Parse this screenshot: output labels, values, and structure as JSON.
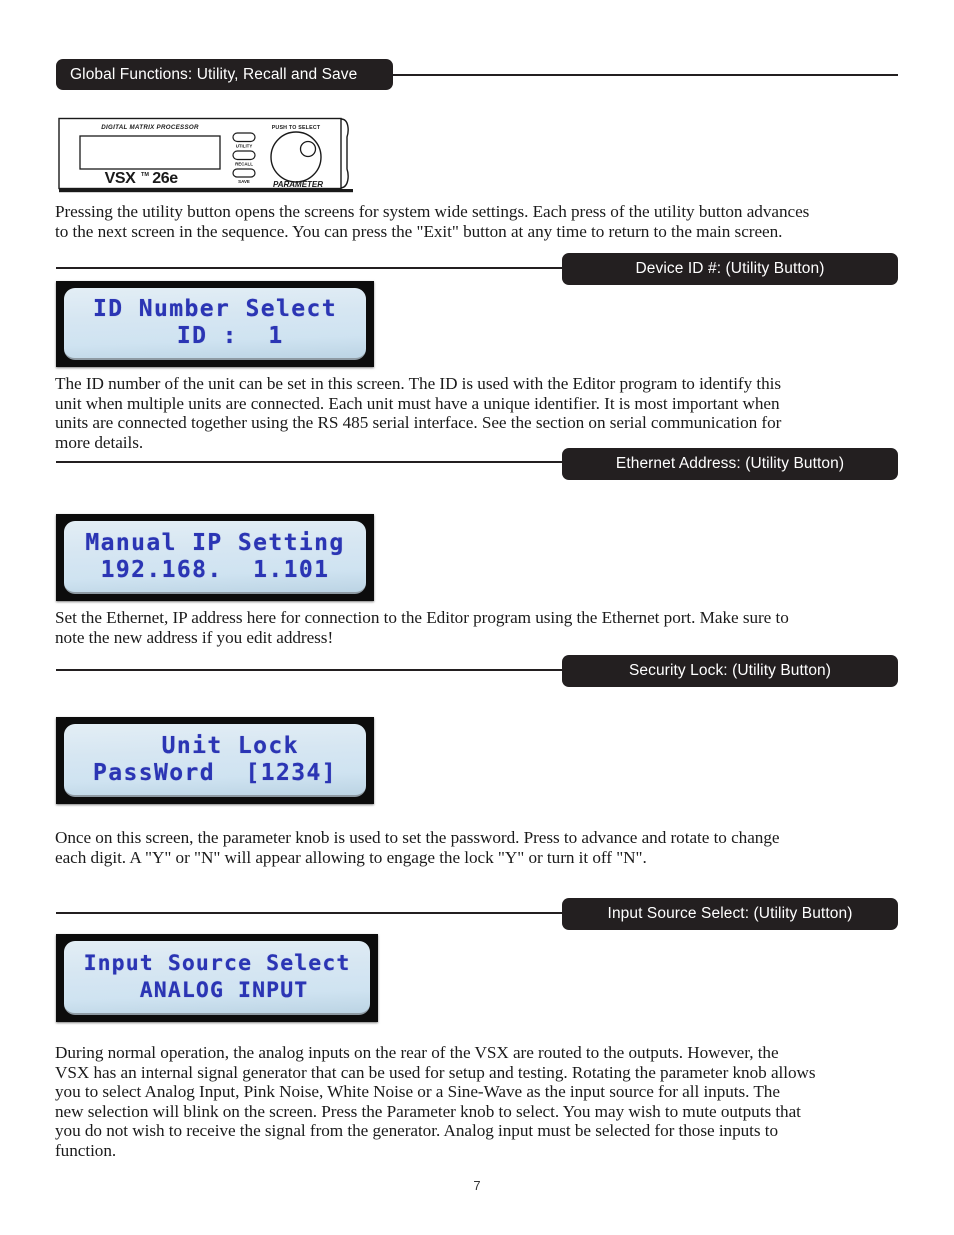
{
  "document": {
    "page_number": "7",
    "section_title": "Global Functions: Utility, Recall and Save"
  },
  "device_illustration": {
    "name": "vsx-26e-front-panel",
    "top_label": "DIGITAL MATRIX PROCESSOR",
    "brand": "VSX",
    "trademark": "™",
    "model": "26e",
    "knob_label_top": "PUSH TO SELECT",
    "knob_label_bottom": "PARAMETER",
    "buttons": [
      "UTILITY",
      "RECALL",
      "SAVE"
    ]
  },
  "intro_paragraph": "Pressing the utility button opens the screens for system wide settings.  Each press of the utility button advances\nto the next screen in the sequence.  You can press the \"Exit\" button at any time to return to the main screen.",
  "sections": [
    {
      "banner": "Device ID #: (Utility Button)",
      "lcd": {
        "line1": "ID Number Select",
        "line2": "  ID :  1"
      },
      "paragraph": "The ID number of the unit can be set in this screen.  The ID is used with the Editor program to identify this\nunit when multiple units are connected.  Each unit must have a unique identifier.  It is most important when\nunits are connected together using the RS 485 serial interface.  See the section on serial communication for\nmore details."
    },
    {
      "banner": "Ethernet Address: (Utility Button)",
      "lcd": {
        "line1": "Manual IP Setting",
        "line2": "192.168.  1.101"
      },
      "paragraph": "Set the Ethernet, IP address here for connection to the Editor program using the Ethernet port. Make sure to\nnote the new address if you edit address!"
    },
    {
      "banner": "Security Lock: (Utility Button)",
      "lcd": {
        "line1": "  Unit Lock",
        "line2": "PassWord  [1234]"
      },
      "paragraph": "Once on this screen, the parameter knob is used to set the password.  Press to advance and rotate to change\neach digit.  A \"Y\" or \"N\" will appear allowing to engage the lock \"Y\" or turn it off \"N\"."
    },
    {
      "banner": "Input Source Select: (Utility Button)",
      "lcd": {
        "line1": "Input Source Select",
        "line2": " ANALOG INPUT"
      },
      "paragraph": "During normal operation, the analog inputs on the rear of the VSX are routed to the outputs.  However, the\nVSX has an internal signal generator that can be used for setup and testing.  Rotating the parameter knob allows\nyou to select Analog Input, Pink Noise, White Noise or a Sine-Wave as the input source for all inputs.  The\nnew selection will blink on the screen.  Press the Parameter knob to select.  You may wish to mute outputs that\nyou do not wish to receive the signal from the generator.   Analog input must be selected for those inputs to\nfunction."
    }
  ],
  "colors": {
    "banner_bg": "#231f20",
    "banner_text": "#ffffff",
    "lcd_text": "#2b35b4",
    "lcd_bg": "#d6e6f2",
    "rule": "#231f20"
  }
}
